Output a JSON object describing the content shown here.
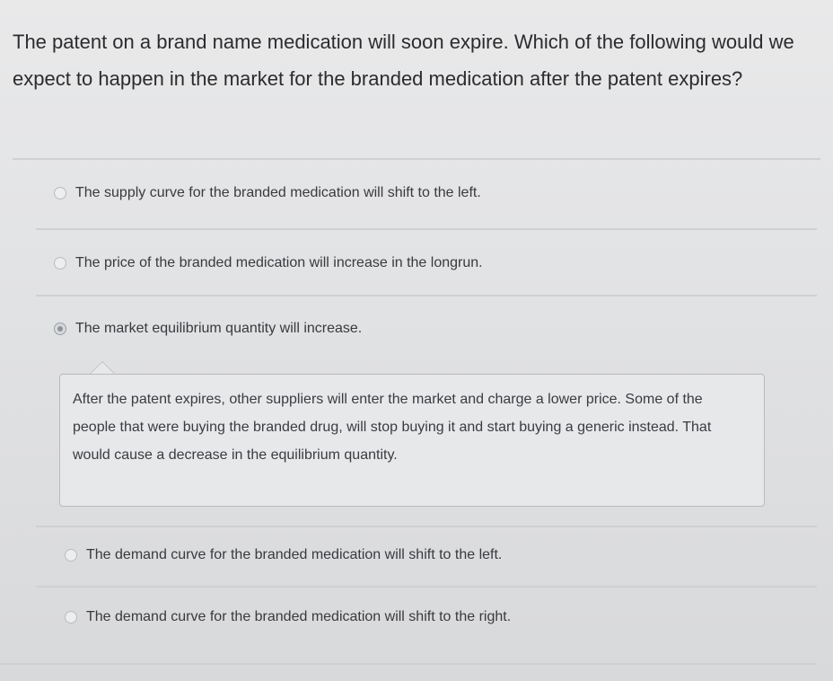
{
  "question": {
    "text": "The patent on a brand name medication will soon expire. Which of the following would we expect to happen in the market for the branded medication after the patent expires?"
  },
  "options": [
    {
      "label": "The supply curve for the branded medication will shift to the left.",
      "selected": false
    },
    {
      "label": "The price of the branded medication will increase in the longrun.",
      "selected": false
    },
    {
      "label": "The market equilibrium quantity will increase.",
      "selected": true
    },
    {
      "label": "The demand curve for the branded medication will shift to the left.",
      "selected": false
    },
    {
      "label": "The demand curve for the branded medication will shift to the right.",
      "selected": false
    }
  ],
  "feedback": {
    "text": "After the patent expires, other suppliers will enter the market and charge a lower price. Some of the people that were buying the branded drug, will stop buying it and start buying a generic instead. That would cause a decrease in the equilibrium quantity."
  }
}
